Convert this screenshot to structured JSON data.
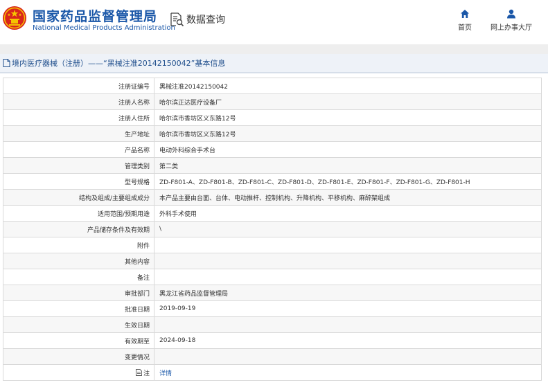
{
  "header": {
    "org_name_cn": "国家药品监督管理局",
    "org_name_en": "National Medical Products Administration",
    "query_label": "数据查询",
    "nav": [
      {
        "label": "首页",
        "icon": "home-icon"
      },
      {
        "label": "网上办事大厅",
        "icon": "user-icon"
      }
    ]
  },
  "breadcrumb": {
    "text": "境内医疗器械（注册）——“黑械注准20142150042”基本信息"
  },
  "rows": [
    {
      "label": "注册证编号",
      "value": "黑械注准20142150042"
    },
    {
      "label": "注册人名称",
      "value": "哈尔滨正达医疗设备厂"
    },
    {
      "label": "注册人住所",
      "value": "哈尔滨市香坊区义东路12号"
    },
    {
      "label": "生产地址",
      "value": "哈尔滨市香坊区义东路12号"
    },
    {
      "label": "产品名称",
      "value": "电动外科综合手术台"
    },
    {
      "label": "管理类别",
      "value": "第二类"
    },
    {
      "label": "型号规格",
      "value": "ZD-F801-A、ZD-F801-B、ZD-F801-C、ZD-F801-D、ZD-F801-E、ZD-F801-F、ZD-F801-G、ZD-F801-H"
    },
    {
      "label": "结构及组成/主要组成成分",
      "value": "本产品主要由台面、台体、电动推杆、控制机构、升降机构、平移机构、麻醉架组成"
    },
    {
      "label": "适用范围/预期用途",
      "value": "外科手术使用"
    },
    {
      "label": "产品储存条件及有效期",
      "value": "\\"
    },
    {
      "label": "附件",
      "value": ""
    },
    {
      "label": "其他内容",
      "value": ""
    },
    {
      "label": "备注",
      "value": ""
    },
    {
      "label": "审批部门",
      "value": "黑龙江省药品监督管理局"
    },
    {
      "label": "批准日期",
      "value": "2019-09-19"
    },
    {
      "label": "生效日期",
      "value": ""
    },
    {
      "label": "有效期至",
      "value": "2024-09-18"
    },
    {
      "label": "变更情况",
      "value": ""
    },
    {
      "label": "注",
      "value": "详情"
    }
  ],
  "colors": {
    "brand_blue": "#1a57a8",
    "emblem_red": "#d9261c",
    "emblem_gold": "#f5c400"
  }
}
